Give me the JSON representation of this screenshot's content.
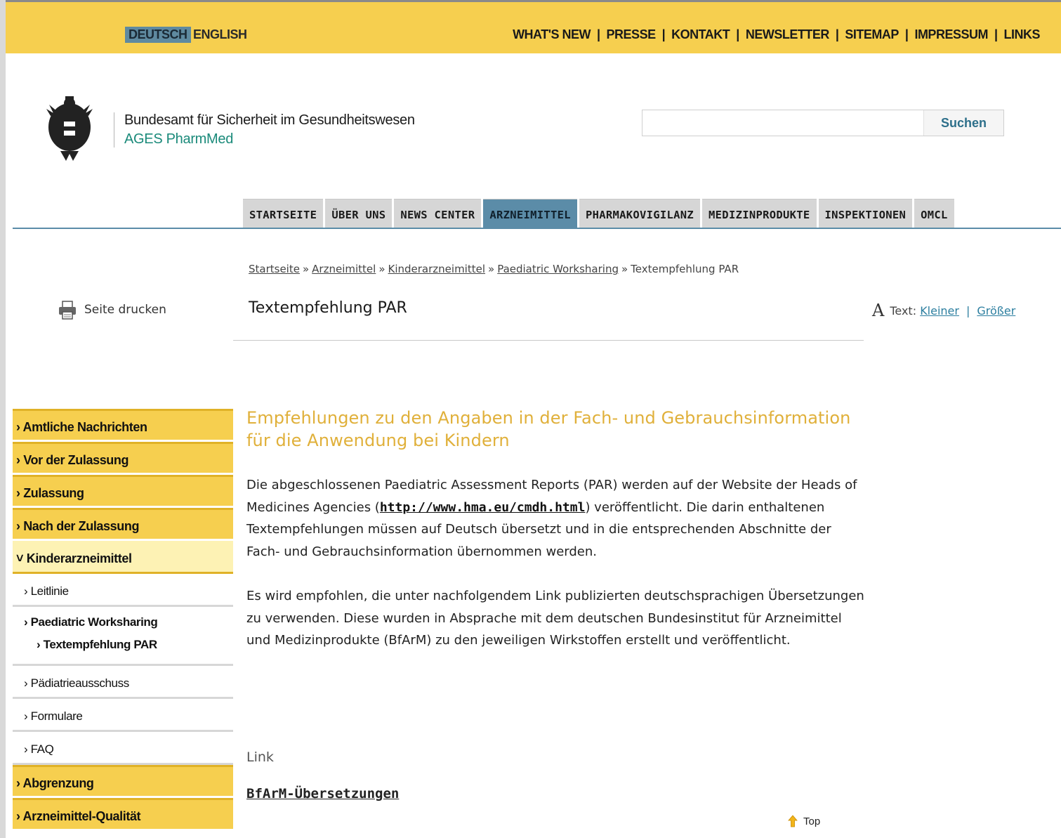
{
  "lang": {
    "de": "DEUTSCH",
    "en": "ENGLISH"
  },
  "topnav": [
    "WHAT'S NEW",
    "PRESSE",
    "KONTAKT",
    "NEWSLETTER",
    "SITEMAP",
    "IMPRESSUM",
    "LINKS"
  ],
  "topnav_separator": "|",
  "org": {
    "name": "Bundesamt für Sicherheit im Gesundheitswesen",
    "sub": "AGES PharmMed"
  },
  "search": {
    "button": "Suchen",
    "value": ""
  },
  "mainnav": [
    "STARTSEITE",
    "ÜBER UNS",
    "NEWS CENTER",
    "ARZNEIMITTEL",
    "PHARMAKOVIGILANZ",
    "MEDIZINPRODUKTE",
    "INSPEKTIONEN",
    "OMCL"
  ],
  "mainnav_active": "ARZNEIMITTEL",
  "breadcrumb": [
    "Startseite",
    "Arzneimittel",
    "Kinderarzneimittel",
    "Paediatric Worksharing"
  ],
  "breadcrumb_current": "Textempfehlung PAR",
  "breadcrumb_sep": "»",
  "print_label": "Seite drucken",
  "page_title": "Textempfehlung PAR",
  "textsize": {
    "icon_letter": "A",
    "label": "Text:",
    "smaller": "Kleiner",
    "pipe": "|",
    "bigger": "Größer"
  },
  "sidebar": {
    "top": [
      {
        "label": "Amtliche Nachrichten"
      },
      {
        "label": "Vor der Zulassung"
      },
      {
        "label": "Zulassung"
      },
      {
        "label": "Nach der Zulassung"
      }
    ],
    "open": {
      "label": "Kinderarzneimittel"
    },
    "sub": [
      {
        "label": "Leitlinie"
      }
    ],
    "group": {
      "label": "Paediatric Worksharing",
      "child": "Textempfehlung PAR"
    },
    "sub2": [
      {
        "label": "Pädiatrieausschuss"
      },
      {
        "label": "Formulare"
      },
      {
        "label": "FAQ"
      }
    ],
    "bottom": [
      {
        "label": "Abgrenzung"
      },
      {
        "label": "Arzneimittel-Qualität"
      }
    ]
  },
  "content": {
    "headline": "Empfehlungen zu den Angaben in der Fach- und Gebrauchsinformation für die Anwendung bei Kindern",
    "para1_before": "Die abgeschlossenen Paediatric Assessment Reports (PAR) werden auf der Website der Heads of Medicines Agencies (",
    "para1_link": "http://www.hma.eu/cmdh.html",
    "para1_after": ") veröffentlicht. Die darin enthaltenen Textempfehlungen müssen auf Deutsch übersetzt und in die entsprechenden Abschnitte der Fach- und Gebrauchsinformation übernommen werden.",
    "para2": "Es wird empfohlen, die unter nachfolgendem Link publizierten deutschsprachigen Übersetzungen zu verwenden. Diese wurden in Absprache mit dem deutschen Bundesinstitut für Arzneimittel und Medizinprodukte (BfArM) zu den jeweiligen Wirkstoffen erstellt und veröffentlicht.",
    "link_heading": "Link",
    "link_label": "BfArM-Übersetzungen",
    "top_label": "Top"
  },
  "colors": {
    "accent_yellow": "#f6cf4f",
    "nav_blue": "#5b8ca8",
    "headline_gold": "#e0b03a",
    "org_teal": "#1a8a7a"
  }
}
